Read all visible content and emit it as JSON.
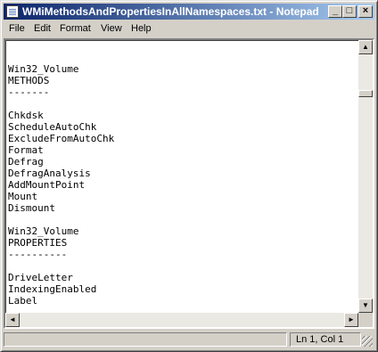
{
  "window": {
    "title": "WMiMethodsAndPropertiesInAllNamespaces.txt - Notepad",
    "icon": "notepad-icon",
    "controls": {
      "minimize": "_",
      "maximize": "□",
      "close": "×"
    }
  },
  "menu": {
    "items": [
      "File",
      "Edit",
      "Format",
      "View",
      "Help"
    ]
  },
  "editor": {
    "lines": [
      "",
      "Win32_Volume",
      "METHODS",
      "-------",
      "",
      "Chkdsk",
      "ScheduleAutoChk",
      "ExcludeFromAutoChk",
      "Format",
      "Defrag",
      "DefragAnalysis",
      "AddMountPoint",
      "Mount",
      "Dismount",
      "",
      "Win32_Volume",
      "PROPERTIES",
      "----------",
      "",
      "DriveLetter",
      "IndexingEnabled",
      "Label"
    ]
  },
  "scrollbars": {
    "up": "▲",
    "down": "▼",
    "left": "◄",
    "right": "►"
  },
  "status": {
    "position": "Ln 1, Col 1"
  }
}
